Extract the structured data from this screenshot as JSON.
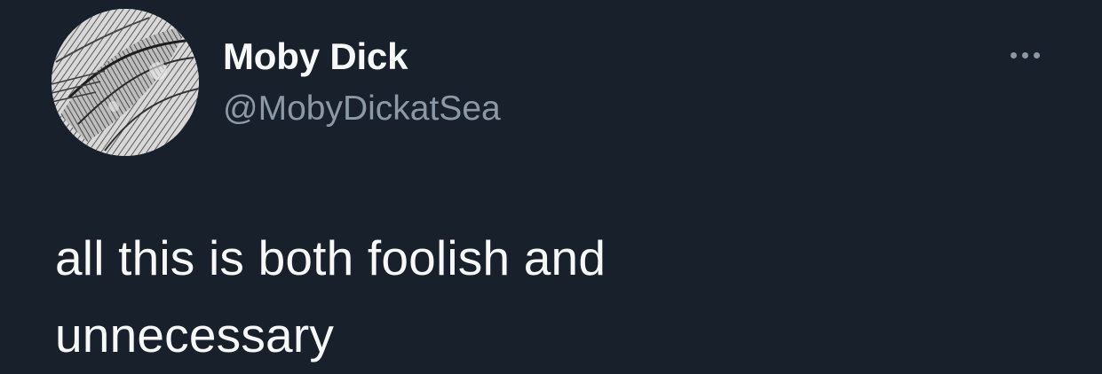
{
  "tweet": {
    "author": {
      "display_name": "Moby Dick",
      "handle": "@MobyDickatSea",
      "avatar_icon": "whale-engraving-avatar"
    },
    "more_icon": "more-options-icon",
    "text_lines": [
      "all this is both foolish and",
      "unnecessary"
    ]
  },
  "colors": {
    "background": "#18202b",
    "primary_text": "#f7f9f9",
    "secondary_text": "#8b98a5"
  }
}
